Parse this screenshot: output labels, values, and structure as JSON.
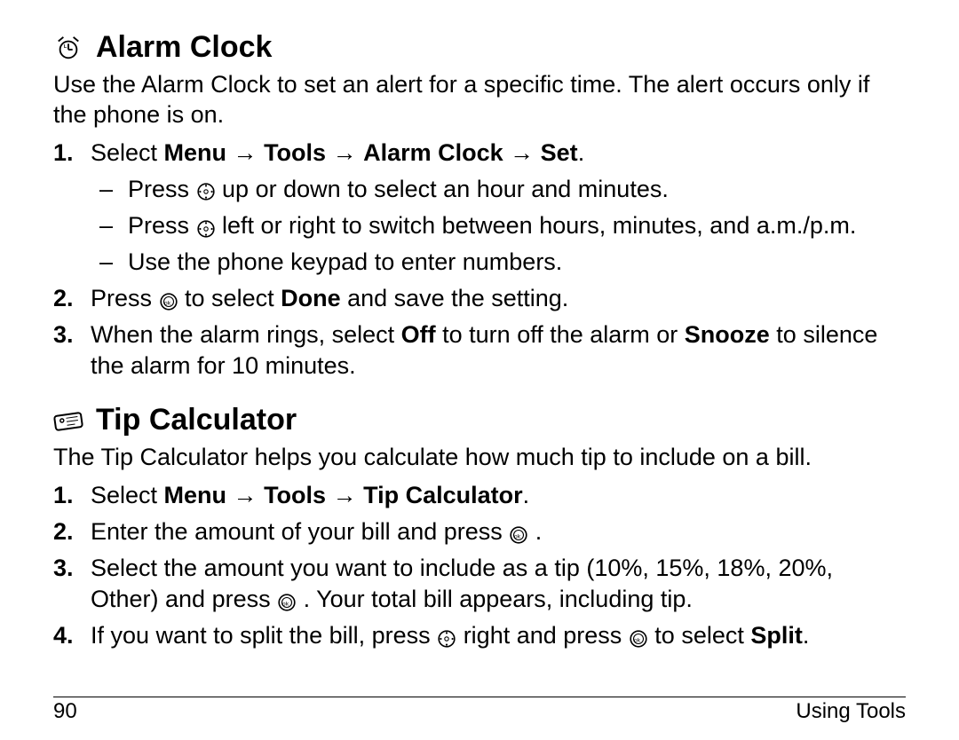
{
  "sections": {
    "alarm": {
      "title": "Alarm Clock",
      "intro": "Use the Alarm Clock to set an alert for a specific time. The alert occurs only if the phone is on.",
      "step1_prefix": "Select ",
      "step1_path_menu": "Menu",
      "step1_path_tools": "Tools",
      "step1_path_alarm": "Alarm Clock",
      "step1_path_set": "Set",
      "arrow": " → ",
      "period": ".",
      "sub1_a": "Press ",
      "sub1_b": " up or down to select an hour and minutes.",
      "sub2_a": "Press ",
      "sub2_b": " left or right to switch between hours, minutes, and a.m./p.m.",
      "sub3": "Use the phone keypad to enter numbers.",
      "step2_a": "Press ",
      "step2_b": " to select ",
      "step2_done": "Done",
      "step2_c": " and save the setting.",
      "step3_a": "When the alarm rings, select ",
      "step3_off": "Off",
      "step3_b": " to turn off the alarm or ",
      "step3_snooze": "Snooze",
      "step3_c": " to silence the alarm for 10 minutes."
    },
    "tip": {
      "title": "Tip Calculator",
      "intro": "The Tip Calculator helps you calculate how much tip to include on a bill.",
      "step1_prefix": "Select ",
      "step1_path_menu": "Menu",
      "step1_path_tools": "Tools",
      "step1_path_tc": "Tip Calculator",
      "step2_a": "Enter the amount of your bill and press ",
      "step2_b": " .",
      "step3_a": "Select the amount you want to include as a tip (10%, 15%, 18%, 20%, Other) and press ",
      "step3_b": " . Your total bill appears, including tip.",
      "step4_a": "If you want to split the bill, press ",
      "step4_b": " right and press ",
      "step4_c": " to select ",
      "step4_split": "Split",
      "step4_d": "."
    }
  },
  "footer": {
    "page_number": "90",
    "section_title": "Using Tools"
  }
}
